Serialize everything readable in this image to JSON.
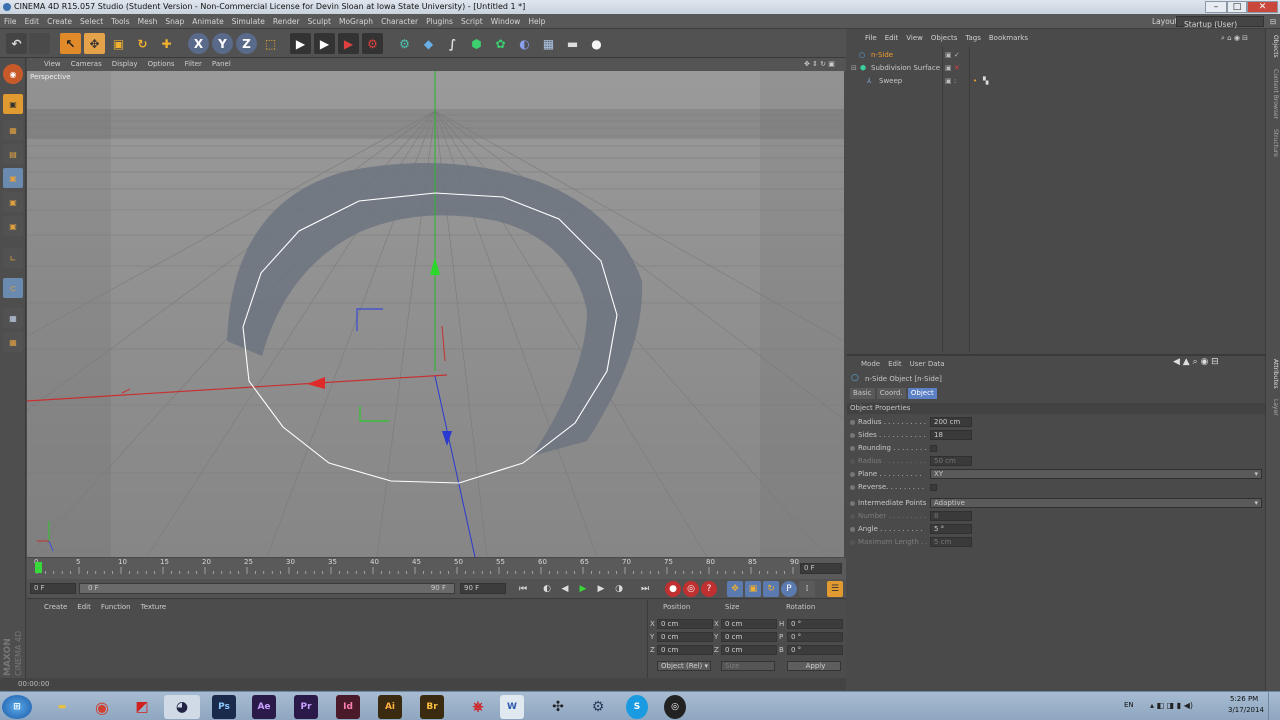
{
  "window": {
    "title": "CINEMA 4D R15.057 Studio (Student Version - Non-Commercial License for Devin Sloan at Iowa State University) - [Untitled 1 *]",
    "layout_label": "Layout:",
    "layout_value": "Startup (User)"
  },
  "menubar": [
    "File",
    "Edit",
    "Create",
    "Select",
    "Tools",
    "Mesh",
    "Snap",
    "Animate",
    "Simulate",
    "Render",
    "Sculpt",
    "MoGraph",
    "Character",
    "Plugins",
    "Script",
    "Window",
    "Help"
  ],
  "toolbar": {
    "axis_labels": [
      "X",
      "Y",
      "Z"
    ]
  },
  "viewport": {
    "menu": [
      "View",
      "Cameras",
      "Display",
      "Options",
      "Filter",
      "Panel"
    ],
    "camera_label": "Perspective"
  },
  "timeline": {
    "ticks": [
      "0",
      "5",
      "10",
      "15",
      "20",
      "25",
      "30",
      "35",
      "40",
      "45",
      "50",
      "55",
      "60",
      "65",
      "70",
      "75",
      "80",
      "85",
      "90"
    ],
    "current_frame": "0 F",
    "start_field": "0 F",
    "slider_start": "0 F",
    "slider_end": "90 F",
    "end_field": "90 F"
  },
  "material_manager": {
    "menu": [
      "Create",
      "Edit",
      "Function",
      "Texture"
    ],
    "brand_line1": "MAXON",
    "brand_line2": "CINEMA 4D"
  },
  "coordinates": {
    "headers": [
      "Position",
      "Size",
      "Rotation"
    ],
    "rows": [
      {
        "axis": "X",
        "pos": "0 cm",
        "size_axis": "X",
        "size": "0 cm",
        "rot_axis": "H",
        "rot": "0 °"
      },
      {
        "axis": "Y",
        "pos": "0 cm",
        "size_axis": "Y",
        "size": "0 cm",
        "rot_axis": "P",
        "rot": "0 °"
      },
      {
        "axis": "Z",
        "pos": "0 cm",
        "size_axis": "Z",
        "size": "0 cm",
        "rot_axis": "B",
        "rot": "0 °"
      }
    ],
    "mode_select": "Object (Rel)",
    "size_select": "Size",
    "apply_button": "Apply"
  },
  "statusbar": {
    "time": "00:00:00"
  },
  "object_manager": {
    "menu": [
      "File",
      "Edit",
      "View",
      "Objects",
      "Tags",
      "Bookmarks"
    ],
    "objects": [
      {
        "name": "n-Side",
        "indent": 0,
        "selected": true
      },
      {
        "name": "Subdivision Surface",
        "indent": 0,
        "selected": false
      },
      {
        "name": "Sweep",
        "indent": 1,
        "selected": false
      }
    ],
    "side_tabs": [
      "Objects",
      "Content Browser",
      "Structure"
    ]
  },
  "attributes": {
    "menu": [
      "Mode",
      "Edit",
      "User Data"
    ],
    "object_title": "n-Side Object [n-Side]",
    "tabs": [
      "Basic",
      "Coord.",
      "Object"
    ],
    "active_tab": "Object",
    "section": "Object Properties",
    "fields": {
      "radius_label": "Radius . . . . . . . . . .",
      "radius_value": "200 cm",
      "sides_label": "Sides . . . . . . . . . . .",
      "sides_value": "18",
      "rounding_label": "Rounding . . . . . . . .",
      "radius2_label": "Radius . . . . . . . . . .",
      "radius2_value": "50 cm",
      "plane_label": "Plane . . . . . . . . . .",
      "plane_value": "XY",
      "reverse_label": "Reverse. . . . . . . . .",
      "intermediate_label": "Intermediate Points",
      "intermediate_value": "Adaptive",
      "number_label": "Number . . . . . . . . .",
      "number_value": "8",
      "angle_label": "Angle . . . . . . . . . .",
      "angle_value": "5 °",
      "maxlen_label": "Maximum Length . .",
      "maxlen_value": "5 cm"
    },
    "side_tabs": [
      "Attributes",
      "Layer"
    ]
  },
  "taskbar": {
    "apps": [
      "start",
      "explorer",
      "chrome",
      "app-red",
      "cinema4d",
      "Ps",
      "Ae",
      "Pr",
      "Id",
      "Ai",
      "Br",
      "acrobat",
      "W",
      "inkscape",
      "steam",
      "skype",
      "obs"
    ],
    "language": "EN",
    "time": "5:26 PM",
    "date": "3/17/2014"
  },
  "colors": {
    "accent_orange": "#e8a23a",
    "select_blue": "#5b80c4",
    "x_axis": "#d03030",
    "y_axis": "#30c030",
    "z_axis": "#3040c8"
  }
}
